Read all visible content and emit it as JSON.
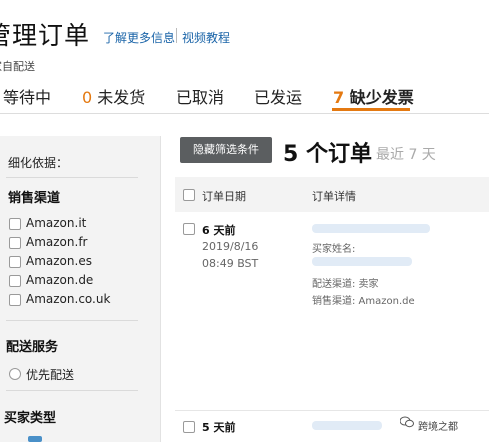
{
  "header": {
    "title": "管理订单",
    "link_more": "了解更多信息",
    "link_video": "视频教程",
    "subtitle": "卖家自配送"
  },
  "tabs": [
    {
      "count": "",
      "label": "等待中"
    },
    {
      "count": "0",
      "label": "未发货"
    },
    {
      "count": "",
      "label": "已取消"
    },
    {
      "count": "",
      "label": "已发运"
    },
    {
      "count": "7",
      "label": "缺少发票"
    }
  ],
  "accent_color": "#e47911",
  "sidebar": {
    "refine_label": "细化依据：",
    "sales_channel_title": "销售渠道",
    "channels": [
      "Amazon.it",
      "Amazon.fr",
      "Amazon.es",
      "Amazon.de",
      "Amazon.co.uk"
    ],
    "shipping_title": "配送服务",
    "shipping_option": "优先配送",
    "buyer_type_title": "买家类型"
  },
  "main": {
    "hide_filters_button": "隐藏筛选条件",
    "order_count": "5 个订单",
    "recent_label": "最近 7 天",
    "columns": {
      "date": "订单日期",
      "details": "订单详情"
    },
    "orders": [
      {
        "age": "6 天前",
        "date": "2019/8/16",
        "time": "08:49 BST",
        "buyer_label": "买家姓名:",
        "fulfillment": "配送渠道: 卖家",
        "sales_channel": "销售渠道: Amazon.de"
      },
      {
        "age": "5 天前"
      }
    ]
  },
  "watermark": {
    "icon": "wechat-icon",
    "text": "跨境之都"
  }
}
